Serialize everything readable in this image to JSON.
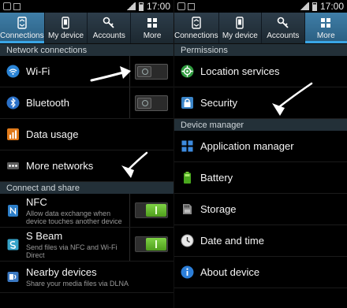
{
  "status_bar": {
    "time": "17:00"
  },
  "left_screen": {
    "tabs": [
      {
        "label": "Connections",
        "icon": "connections-icon",
        "active": true
      },
      {
        "label": "My device",
        "icon": "phone-icon",
        "active": false
      },
      {
        "label": "Accounts",
        "icon": "key-icon",
        "active": false
      },
      {
        "label": "More",
        "icon": "grid-icon",
        "active": false
      }
    ],
    "section_network": "Network connections",
    "wifi": {
      "label": "Wi-Fi",
      "icon": "wifi-icon",
      "toggle": "off"
    },
    "bluetooth": {
      "label": "Bluetooth",
      "icon": "bluetooth-icon",
      "toggle": "off"
    },
    "data_usage": {
      "label": "Data usage",
      "icon": "data-usage-icon"
    },
    "more_networks": {
      "label": "More networks",
      "icon": "more-dots-icon"
    },
    "section_share": "Connect and share",
    "nfc": {
      "label": "NFC",
      "subtitle": "Allow data exchange when device touches another device",
      "icon": "nfc-icon",
      "toggle": "on"
    },
    "sbeam": {
      "label": "S Beam",
      "subtitle": "Send files via NFC and Wi-Fi Direct",
      "icon": "sbeam-icon",
      "toggle": "on"
    },
    "nearby": {
      "label": "Nearby devices",
      "subtitle": "Share your media files via DLNA",
      "icon": "nearby-devices-icon"
    }
  },
  "right_screen": {
    "tabs": [
      {
        "label": "Connections",
        "icon": "connections-icon",
        "active": false
      },
      {
        "label": "My device",
        "icon": "phone-icon",
        "active": false
      },
      {
        "label": "Accounts",
        "icon": "key-icon",
        "active": false
      },
      {
        "label": "More",
        "icon": "grid-icon",
        "active": true
      }
    ],
    "section_permissions": "Permissions",
    "location": {
      "label": "Location services",
      "icon": "location-icon"
    },
    "security": {
      "label": "Security",
      "icon": "lock-icon"
    },
    "section_device": "Device manager",
    "app_manager": {
      "label": "Application manager",
      "icon": "apps-grid-icon"
    },
    "battery": {
      "label": "Battery",
      "icon": "battery-icon"
    },
    "storage": {
      "label": "Storage",
      "icon": "storage-icon"
    },
    "date_time": {
      "label": "Date and time",
      "icon": "clock-icon"
    },
    "about": {
      "label": "About device",
      "icon": "info-icon"
    }
  },
  "colors": {
    "tab_active": "#3f7ea8",
    "tab_indicator": "#3aa6e6",
    "section_header_bg": "#233038",
    "toggle_on": "#6cc532",
    "background": "#000000"
  }
}
